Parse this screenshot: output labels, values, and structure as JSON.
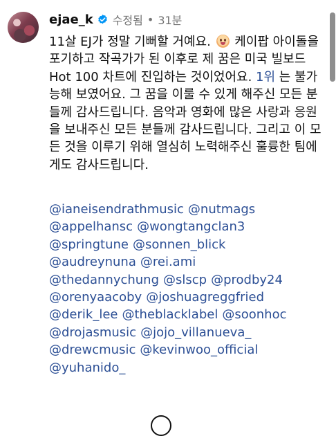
{
  "post": {
    "username": "ejae_k",
    "edited": "수정됨",
    "separator": "•",
    "time_ago": "31분",
    "caption": {
      "part1": "11살 EJ가 정말 기뻐할 거예요.",
      "part2": " 케이팝 아이돌을 포기하고 작곡가가 된 이후로 제 꿈은 미국 빌보드 Hot 100 차트에 진입하는 것이었어요. ",
      "rank_link": "1위",
      "part3": " 는 불가능해 보였어요. 그 꿈을 이룰 수 있게 해주신 모든 분들께 감사드립니다. 음악과 영화에 많은 사랑과 응원을 보내주신 모든 분들께 감사드립니다. 그리고 이 모든 것을 이루기 위해 열심히 노력해주신 훌륭한 팀에게도 감사드립니다."
    },
    "mention_lines": [
      [
        "@ianeisendrathmusic",
        "@nutmags"
      ],
      [
        "@appelhansc",
        "@wongtangclan3"
      ],
      [
        "@springtune",
        "@sonnen_blick"
      ],
      [
        "@audreynuna",
        "@rei.ami"
      ],
      [
        "@thedannychung",
        "@slscp",
        "@prodby24"
      ],
      [
        "@orenyaacoby",
        "@joshuagreggfried"
      ],
      [
        "@derik_lee",
        "@theblacklabel",
        "@soonhoc"
      ],
      [
        "@drojasmusic",
        "@jojo_villanueva_"
      ],
      [
        "@drewcmusic",
        "@kevinwoo_official"
      ],
      [
        "@yuhanido_"
      ]
    ]
  },
  "icons": {
    "avatar": "profile-photo",
    "verified": "verified-badge-icon",
    "emoji": "smiling-face-emoji",
    "bottom": "circle-icon"
  },
  "colors": {
    "link": "#2c4f95",
    "verified": "#0095f6",
    "muted": "#737373"
  }
}
